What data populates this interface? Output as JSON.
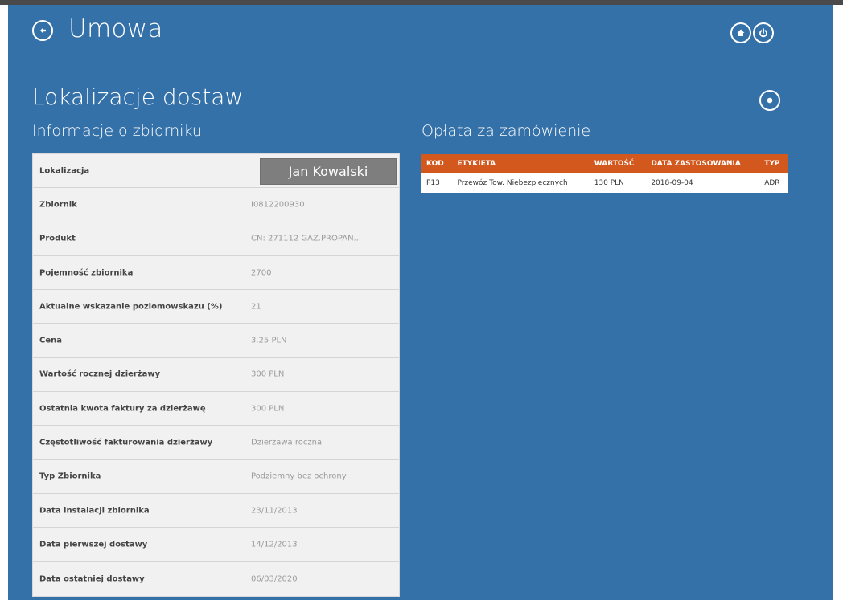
{
  "header": {
    "title": "Umowa"
  },
  "section": {
    "title": "Lokalizacje dostaw",
    "left_subtitle": "Informacje o zbiorniku",
    "right_subtitle": "Opłata za zamówienie"
  },
  "info": {
    "location_label": "Lokalizacja",
    "location_button": "Jan Kowalski",
    "rows": [
      {
        "label": "Zbiornik",
        "value": "I0812200930"
      },
      {
        "label": "Produkt",
        "value": "CN: 271112 GAZ.PROPAN..."
      },
      {
        "label": "Pojemność zbiornika",
        "value": "2700"
      },
      {
        "label": "Aktualne wskazanie poziomowskazu (%)",
        "value": "21"
      },
      {
        "label": "Cena",
        "value": "3.25 PLN"
      },
      {
        "label": "Wartość rocznej dzierżawy",
        "value": "300 PLN"
      },
      {
        "label": "Ostatnia kwota faktury za dzierżawę",
        "value": "300 PLN"
      },
      {
        "label": "Częstotliwość fakturowania dzierżawy",
        "value": "Dzierżawa roczna"
      },
      {
        "label": "Typ Zbiornika",
        "value": "Podziemny bez ochrony"
      },
      {
        "label": "Data instalacji zbiornika",
        "value": "23/11/2013"
      },
      {
        "label": "Data pierwszej dostawy",
        "value": "14/12/2013"
      },
      {
        "label": "Data ostatniej dostawy",
        "value": "06/03/2020"
      }
    ]
  },
  "fees": {
    "headers": [
      "KOD",
      "ETYKIETA",
      "WARTOŚĆ",
      "DATA ZASTOSOWANIA",
      "TYP"
    ],
    "rows": [
      [
        "P13",
        "Przewóz Tow. Niebezpiecznych",
        "130 PLN",
        "2018-09-04",
        "ADR"
      ]
    ]
  },
  "icons": {
    "back": "back-arrow-icon",
    "home": "home-icon",
    "power": "power-icon",
    "record": "record-icon"
  },
  "colors": {
    "background": "#3571a9",
    "table_header": "#d2581e",
    "location_button": "#7e7e7e"
  }
}
